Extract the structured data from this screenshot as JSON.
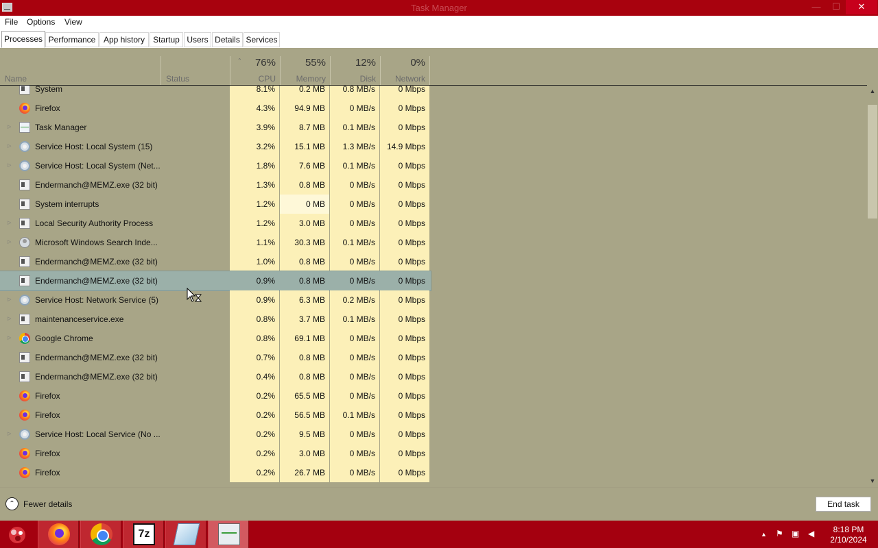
{
  "window": {
    "title": "Task Manager",
    "minimize_glyph": "—",
    "maximize_glyph": "☐",
    "close_glyph": "✕"
  },
  "menu": [
    "File",
    "Options",
    "View"
  ],
  "tabs": [
    {
      "label": "Processes",
      "active": true
    },
    {
      "label": "Performance",
      "active": false
    },
    {
      "label": "App history",
      "active": false
    },
    {
      "label": "Startup",
      "active": false
    },
    {
      "label": "Users",
      "active": false
    },
    {
      "label": "Details",
      "active": false
    },
    {
      "label": "Services",
      "active": false
    }
  ],
  "columns": {
    "name": "Name",
    "status": "Status",
    "cpu": {
      "label": "CPU",
      "percent": "76%"
    },
    "memory": {
      "label": "Memory",
      "percent": "55%"
    },
    "disk": {
      "label": "Disk",
      "percent": "12%"
    },
    "network": {
      "label": "Network",
      "percent": "0%"
    }
  },
  "processes": [
    {
      "name": "System",
      "icon": "window-icon",
      "expandable": false,
      "cpu": "8.1%",
      "memory": "0.2 MB",
      "disk": "0.8 MB/s",
      "network": "0 Mbps"
    },
    {
      "name": "Firefox",
      "icon": "firefox-icon",
      "expandable": false,
      "cpu": "4.3%",
      "memory": "94.9 MB",
      "disk": "0 MB/s",
      "network": "0 Mbps"
    },
    {
      "name": "Task Manager",
      "icon": "task-manager-icon",
      "expandable": true,
      "cpu": "3.9%",
      "memory": "8.7 MB",
      "disk": "0.1 MB/s",
      "network": "0 Mbps"
    },
    {
      "name": "Service Host: Local System (15)",
      "icon": "gear-icon",
      "expandable": true,
      "cpu": "3.2%",
      "memory": "15.1 MB",
      "disk": "1.3 MB/s",
      "network": "14.9 Mbps"
    },
    {
      "name": "Service Host: Local System (Net...",
      "icon": "gear-icon",
      "expandable": true,
      "cpu": "1.8%",
      "memory": "7.6 MB",
      "disk": "0.1 MB/s",
      "network": "0 Mbps"
    },
    {
      "name": "Endermanch@MEMZ.exe (32 bit)",
      "icon": "window-icon",
      "expandable": false,
      "cpu": "1.3%",
      "memory": "0.8 MB",
      "disk": "0 MB/s",
      "network": "0 Mbps"
    },
    {
      "name": "System interrupts",
      "icon": "window-icon",
      "expandable": false,
      "cpu": "1.2%",
      "memory": "0 MB",
      "disk": "0 MB/s",
      "network": "0 Mbps"
    },
    {
      "name": "Local Security Authority Process",
      "icon": "window-icon",
      "expandable": true,
      "cpu": "1.2%",
      "memory": "3.0 MB",
      "disk": "0 MB/s",
      "network": "0 Mbps"
    },
    {
      "name": "Microsoft Windows Search Inde...",
      "icon": "search-indexer-icon",
      "expandable": true,
      "cpu": "1.1%",
      "memory": "30.3 MB",
      "disk": "0.1 MB/s",
      "network": "0 Mbps"
    },
    {
      "name": "Endermanch@MEMZ.exe (32 bit)",
      "icon": "window-icon",
      "expandable": false,
      "cpu": "1.0%",
      "memory": "0.8 MB",
      "disk": "0 MB/s",
      "network": "0 Mbps"
    },
    {
      "name": "Endermanch@MEMZ.exe (32 bit)",
      "icon": "window-icon",
      "expandable": false,
      "cpu": "0.9%",
      "memory": "0.8 MB",
      "disk": "0 MB/s",
      "network": "0 Mbps",
      "selected": true
    },
    {
      "name": "Service Host: Network Service (5)",
      "icon": "gear-icon",
      "expandable": true,
      "cpu": "0.9%",
      "memory": "6.3 MB",
      "disk": "0.2 MB/s",
      "network": "0 Mbps"
    },
    {
      "name": "maintenanceservice.exe",
      "icon": "window-icon",
      "expandable": true,
      "cpu": "0.8%",
      "memory": "3.7 MB",
      "disk": "0.1 MB/s",
      "network": "0 Mbps"
    },
    {
      "name": "Google Chrome",
      "icon": "chrome-icon",
      "expandable": true,
      "cpu": "0.8%",
      "memory": "69.1 MB",
      "disk": "0 MB/s",
      "network": "0 Mbps"
    },
    {
      "name": "Endermanch@MEMZ.exe (32 bit)",
      "icon": "window-icon",
      "expandable": false,
      "cpu": "0.7%",
      "memory": "0.8 MB",
      "disk": "0 MB/s",
      "network": "0 Mbps"
    },
    {
      "name": "Endermanch@MEMZ.exe (32 bit)",
      "icon": "window-icon",
      "expandable": false,
      "cpu": "0.4%",
      "memory": "0.8 MB",
      "disk": "0 MB/s",
      "network": "0 Mbps"
    },
    {
      "name": "Firefox",
      "icon": "firefox-icon",
      "expandable": false,
      "cpu": "0.2%",
      "memory": "65.5 MB",
      "disk": "0 MB/s",
      "network": "0 Mbps"
    },
    {
      "name": "Firefox",
      "icon": "firefox-icon",
      "expandable": false,
      "cpu": "0.2%",
      "memory": "56.5 MB",
      "disk": "0.1 MB/s",
      "network": "0 Mbps"
    },
    {
      "name": "Service Host: Local Service (No ...",
      "icon": "gear-icon",
      "expandable": true,
      "cpu": "0.2%",
      "memory": "9.5 MB",
      "disk": "0 MB/s",
      "network": "0 Mbps"
    },
    {
      "name": "Firefox",
      "icon": "firefox-icon",
      "expandable": false,
      "cpu": "0.2%",
      "memory": "3.0 MB",
      "disk": "0 MB/s",
      "network": "0 Mbps"
    },
    {
      "name": "Firefox",
      "icon": "firefox-icon",
      "expandable": false,
      "cpu": "0.2%",
      "memory": "26.7 MB",
      "disk": "0 MB/s",
      "network": "0 Mbps"
    }
  ],
  "footer": {
    "fewer_details": "Fewer details",
    "end_task": "End task"
  },
  "taskbar": {
    "apps": [
      "firefox-icon",
      "chrome-icon",
      "7zip-icon",
      "notepad-icon",
      "task-manager-icon"
    ],
    "seven_zip_label": "7z",
    "tray_glyphs": {
      "chevron": "▲",
      "flag": "⚑",
      "network": "▣",
      "volume": "◀"
    },
    "time": "8:18 PM",
    "date": "2/10/2024"
  },
  "colors": {
    "titlebar": "#a8020e",
    "taskbar": "#a4000f",
    "background": "#a8a587",
    "heat_cell": "#fcf0b8",
    "selected_row": "#9bb0a9"
  }
}
